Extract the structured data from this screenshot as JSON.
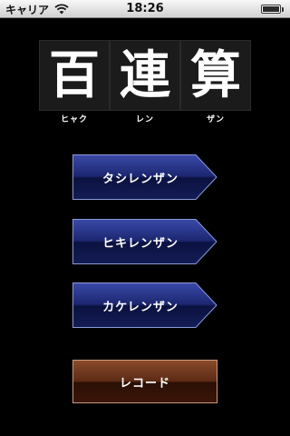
{
  "status_bar": {
    "carrier": "キャリア",
    "time": "18:26"
  },
  "title": {
    "kanji": [
      "百",
      "連",
      "算"
    ],
    "readings": [
      "ヒャク",
      "レン",
      "ザン"
    ]
  },
  "menu": {
    "buttons": [
      {
        "label": "タシレンザン"
      },
      {
        "label": "ヒキレンザン"
      },
      {
        "label": "カケレンザン"
      }
    ],
    "record_label": "レコード"
  },
  "colors": {
    "button_blue_top": "#3a4aa8",
    "button_blue_bottom": "#0b1240",
    "record_brown": "#5a2a14",
    "background": "#000000"
  }
}
